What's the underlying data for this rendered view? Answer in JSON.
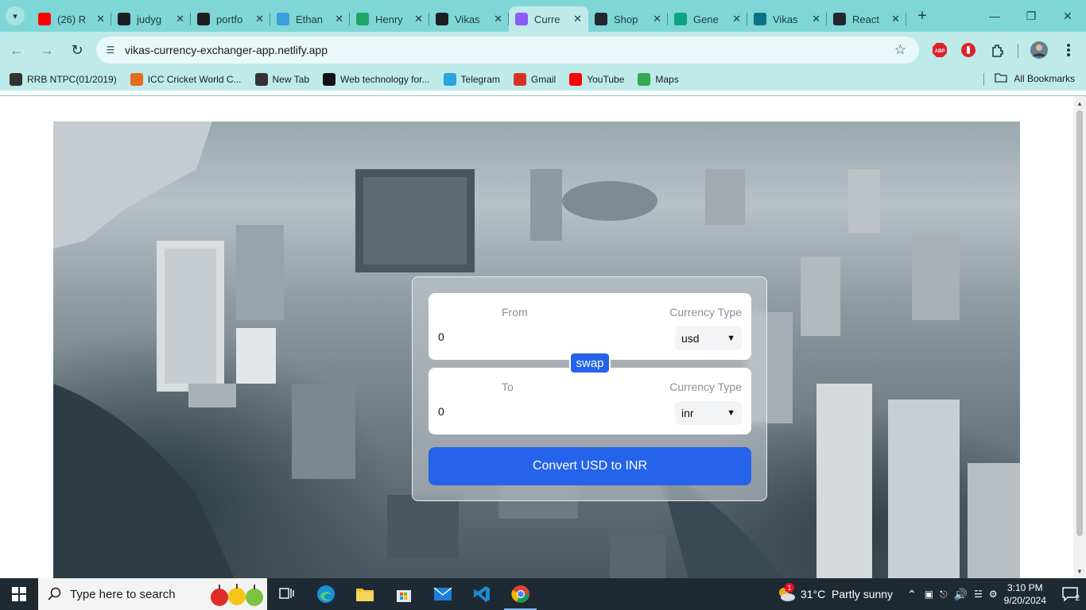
{
  "browser": {
    "tabs": [
      {
        "title": "(26) R",
        "icon": "youtube-icon",
        "color": "#ff0000",
        "active": false
      },
      {
        "title": "judyg",
        "icon": "github-icon",
        "color": "#1b1f23",
        "active": false
      },
      {
        "title": "portfo",
        "icon": "github-icon",
        "color": "#1b1f23",
        "active": false
      },
      {
        "title": "Ethan",
        "icon": "globe-icon",
        "color": "#3aa0e0",
        "active": false
      },
      {
        "title": "Henry",
        "icon": "drive-icon",
        "color": "#1fa463",
        "active": false
      },
      {
        "title": "Vikas",
        "icon": "github-icon",
        "color": "#1b1f23",
        "active": false
      },
      {
        "title": "Curre",
        "icon": "vite-icon",
        "color": "#8b5cf6",
        "active": true
      },
      {
        "title": "Shop",
        "icon": "react-icon",
        "color": "#23272f",
        "active": false
      },
      {
        "title": "Gene",
        "icon": "diamond-icon",
        "color": "#10a37f",
        "active": false
      },
      {
        "title": "Vikas",
        "icon": "vscode-icon",
        "color": "#0b7285",
        "active": false
      },
      {
        "title": "React",
        "icon": "react-icon",
        "color": "#23272f",
        "active": false
      }
    ],
    "url": "vikas-currency-exchanger-app.netlify.app",
    "bookmarks": [
      {
        "label": "RRB NTPC(01/2019)",
        "icon": "globe-icon",
        "color": "#333333"
      },
      {
        "label": "ICC Cricket World C...",
        "icon": "cricket-icon",
        "color": "#e56b1f"
      },
      {
        "label": "New Tab",
        "icon": "globe-icon",
        "color": "#333333"
      },
      {
        "label": "Web technology for...",
        "icon": "book-icon",
        "color": "#111111"
      },
      {
        "label": "Telegram",
        "icon": "telegram-icon",
        "color": "#2aa3df"
      },
      {
        "label": "Gmail",
        "icon": "gmail-icon",
        "color": "#d93025"
      },
      {
        "label": "YouTube",
        "icon": "youtube-icon",
        "color": "#ff0000"
      },
      {
        "label": "Maps",
        "icon": "maps-icon",
        "color": "#34a853"
      }
    ],
    "all_bookmarks": "All Bookmarks"
  },
  "converter": {
    "from_label": "From",
    "to_label": "To",
    "currency_type_label": "Currency Type",
    "from_amount": "0",
    "to_amount": "0",
    "from_currency": "usd",
    "to_currency": "inr",
    "swap_label": "swap",
    "convert_label": "Convert USD to INR",
    "accent": "#2563eb"
  },
  "taskbar": {
    "search_placeholder": "Type here to search",
    "weather": "31°C  Partly sunny",
    "weather_badge": "1",
    "time": "3:10 PM",
    "date": "9/20/2024",
    "notifications": "2"
  }
}
